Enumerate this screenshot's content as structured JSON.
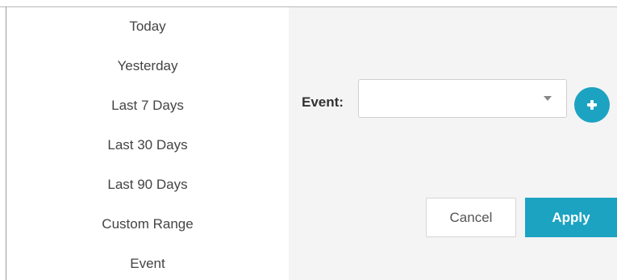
{
  "date_ranges": {
    "items": [
      {
        "label": "Today"
      },
      {
        "label": "Yesterday"
      },
      {
        "label": "Last 7 Days"
      },
      {
        "label": "Last 30 Days"
      },
      {
        "label": "Last 90 Days"
      },
      {
        "label": "Custom Range"
      },
      {
        "label": "Event"
      }
    ]
  },
  "event_filter": {
    "label": "Event:",
    "selected_value": "",
    "caret_icon": "chevron-down-icon",
    "add_icon": "plus-icon"
  },
  "actions": {
    "cancel_label": "Cancel",
    "apply_label": "Apply"
  },
  "colors": {
    "accent": "#1ca3c2",
    "panel_background": "#f4f4f4"
  }
}
